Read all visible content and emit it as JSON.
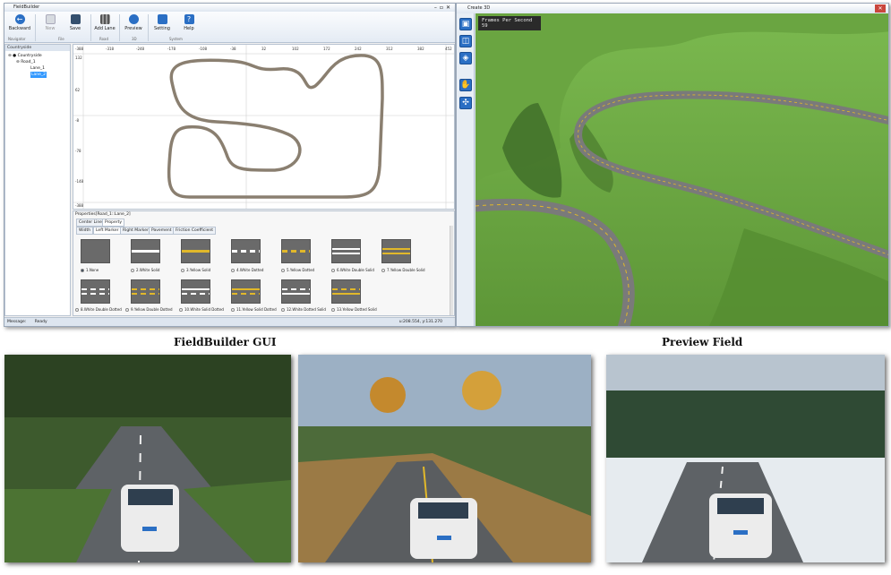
{
  "fieldbuilder": {
    "title": "FieldBuilder",
    "ribbon": {
      "buttons": [
        {
          "label": "Backward",
          "icon": "backward-arrow-icon"
        },
        {
          "label": "New",
          "icon": "new-document-icon"
        },
        {
          "label": "Save",
          "icon": "save-disk-icon"
        },
        {
          "label": "Add Lane",
          "icon": "add-lane-icon"
        },
        {
          "label": "Preview",
          "icon": "eye-icon"
        },
        {
          "label": "Setting",
          "icon": "setting-icon"
        },
        {
          "label": "Help",
          "icon": "help-icon"
        }
      ],
      "groups": [
        "Navigator",
        "File",
        "Road",
        "3D",
        "System"
      ]
    },
    "tree": {
      "header": "Countryside",
      "root": "Countryside",
      "road": "Road_1",
      "lanes": [
        "Lane_1",
        "Lane_2"
      ],
      "selected": "Lane_2"
    },
    "canvas": {
      "x_ticks": [
        "-388",
        "-318",
        "-248",
        "-178",
        "-108",
        "-38",
        "32",
        "102",
        "172",
        "242",
        "312",
        "382",
        "452"
      ],
      "y_ticks": [
        "132",
        "62",
        "-8",
        "-78",
        "-148",
        "-388"
      ]
    },
    "properties": {
      "title": "Properties[Road_1::Lane_2]",
      "tabs": [
        "Center Line",
        "Property"
      ],
      "subtabs": [
        "Width",
        "Left Marker",
        "Right Marker",
        "Pavement",
        "Friction Coefficient"
      ],
      "active_subtab": "Left Marker",
      "markers": [
        "1.None",
        "2.White Solid",
        "3.Yellow Solid",
        "4.White Dotted",
        "5.Yellow Dotted",
        "6.White Double Solid",
        "7.Yellow Double Solid",
        "8.White Double Dotted",
        "9.Yellow Double Dotted",
        "10.White Solid Dotted",
        "11.Yellow Solid Dotted",
        "12.White Dotted Solid",
        "13.Yellow Dotted Solid"
      ],
      "selected_marker": "1.None"
    },
    "status": {
      "label": "Message:",
      "value": "Ready",
      "coords": "u:208.554, y:131.270"
    }
  },
  "create3d": {
    "title": "Create 3D",
    "fps_label": "Frames Per Second 59",
    "tools": [
      "layout-single-icon",
      "layout-split-icon",
      "navigate-icon",
      "hand-icon",
      "fit-view-icon"
    ]
  },
  "captions": {
    "left": "FieldBuilder GUI",
    "right": "Preview Field"
  },
  "colors": {
    "ribbon_blue": "#2b6fc4",
    "terrain_green": "#5f9a3c",
    "road_gray": "#6e6e6e",
    "lane_yellow": "#e1b82a"
  }
}
